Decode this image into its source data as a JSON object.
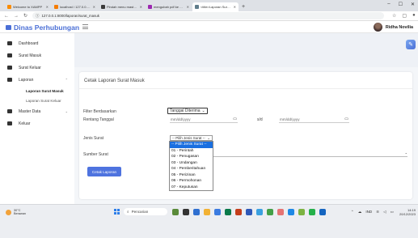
{
  "browser": {
    "tabs": [
      {
        "title": "Welcome to XAMPP",
        "color": "#fb8c00",
        "active": false
      },
      {
        "title": "localhost / 127.0.0.1 / surat / s",
        "color": "#f57c00",
        "active": false
      },
      {
        "title": "Pindah menu master data",
        "color": "#3a3a3a",
        "active": false
      },
      {
        "title": "mengubah pdf ke word online",
        "color": "#9c27b0",
        "active": false
      },
      {
        "title": "<title>Laporan Surat Masuk",
        "color": "#607d8b",
        "active": true
      }
    ],
    "url": "127.0.0.1:8000/laporan/surat_masuk"
  },
  "header": {
    "brand": "Dinas Perhubungan",
    "user_name": "Ridha Novilia"
  },
  "sidebar": {
    "items": [
      {
        "label": "Dashboard",
        "name": "dashboard"
      },
      {
        "label": "Surat Masuk",
        "name": "surat-masuk"
      },
      {
        "label": "Surat Keluar",
        "name": "surat-keluar"
      },
      {
        "label": "Laporan",
        "name": "laporan"
      },
      {
        "label": "Master Data",
        "name": "master-data"
      },
      {
        "label": "Keluar",
        "name": "keluar"
      }
    ],
    "sub_items": [
      {
        "label": "Laporan Surat Masuk"
      },
      {
        "label": "Laporan Surat Keluar"
      }
    ]
  },
  "form": {
    "title": "Cetak Laporan Surat Masuk",
    "filter_label": "Filter Berdasarkan",
    "filter_value": "Tanggal Diterima",
    "rentang_label": "Rentang Tanggal",
    "date_placeholder": "mm/dd/yyyy",
    "sd_label": "s/d",
    "jenis_label": "Jenis Surat",
    "jenis_value": "-- Pilih Jenis Surat --",
    "sumber_label": "Sumber Surat",
    "button_label": "Cetak Laporan"
  },
  "dropdown": {
    "options": [
      "-- Pilih Jenis Surat --",
      "01 - Perintah",
      "02 - Penugasan",
      "03 - Undangan",
      "04 - Pemberitahuan",
      "05 - Perizinan",
      "06 - Permohonan",
      "07 - Keputusan"
    ],
    "selected_index": 0
  },
  "taskbar": {
    "weather_temp": "30°C",
    "weather_desc": "Berawan",
    "search_placeholder": "Pencarian",
    "lang": "IND",
    "time": "14:19",
    "date": "20/12/2023"
  }
}
